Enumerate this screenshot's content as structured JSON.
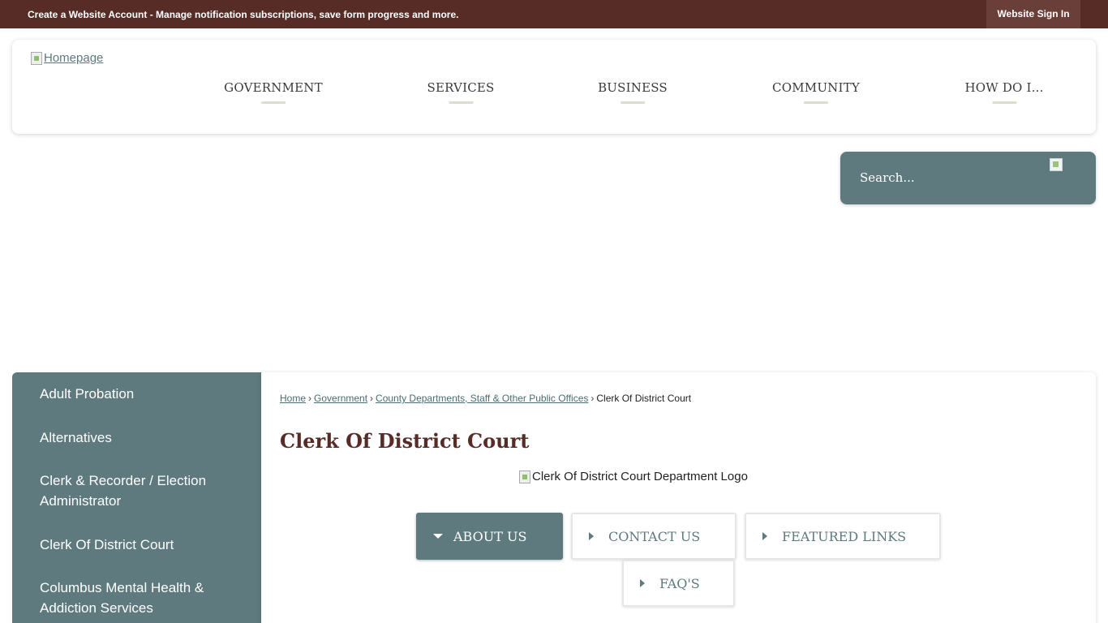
{
  "top_bar": {
    "message": "Create a Website Account - Manage notification subscriptions, save form progress and more.",
    "signin_label": "Website Sign In"
  },
  "header": {
    "logo_alt": "Homepage",
    "nav": [
      "GOVERNMENT",
      "SERVICES",
      "BUSINESS",
      "COMMUNITY",
      "HOW DO I..."
    ]
  },
  "search": {
    "placeholder": "Search..."
  },
  "sidebar": {
    "items": [
      "Adult Probation",
      "Alternatives",
      "Clerk & Recorder / Election Administrator",
      "Clerk Of District Court",
      "Columbus Mental Health & Addiction Services"
    ]
  },
  "breadcrumb": {
    "home": "Home",
    "government": "Government",
    "departments": "County Departments, Staff & Other Public Offices",
    "current": "Clerk Of District Court",
    "separator": "›"
  },
  "page": {
    "title": "Clerk Of District Court",
    "logo_alt": "Clerk Of District Court Department Logo"
  },
  "tabs": {
    "about": "ABOUT US",
    "contact": "CONTACT US",
    "featured": "FEATURED LINKS",
    "faq": "FAQ'S"
  }
}
